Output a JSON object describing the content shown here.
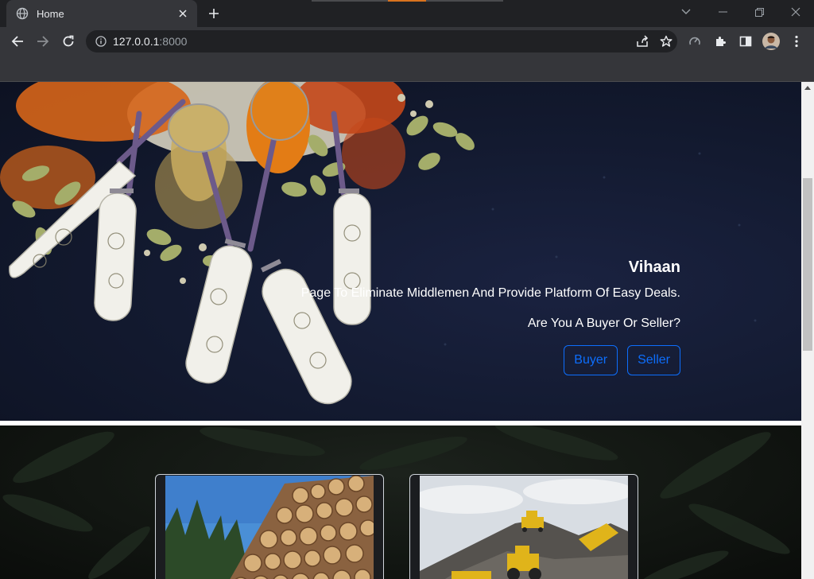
{
  "browser": {
    "tab_title": "Home",
    "url_host": "127.0.0.1",
    "url_port": ":8000"
  },
  "hero": {
    "title": "Vihaan",
    "subtitle": "Page To Eliminate Middlemen And Provide Platform Of Easy Deals.",
    "question": "Are You A Buyer Or Seller?",
    "buyer_label": "Buyer",
    "seller_label": "Seller",
    "accent_color": "#0d6efd"
  },
  "cards": [
    {
      "image": "timber-logs-photo"
    },
    {
      "image": "construction-loader-photo"
    }
  ]
}
